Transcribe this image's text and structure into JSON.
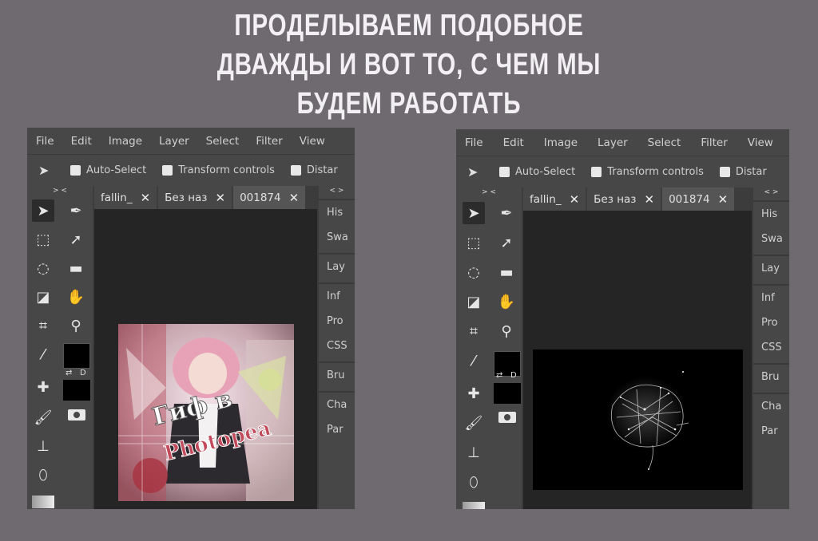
{
  "caption": {
    "line1": "ПРОДЕЛЫВАЕМ ПОДОБНОЕ",
    "line2": "ДВАЖДЫ И ВОТ ТО, С ЧЕМ МЫ",
    "line3": "БУДЕМ РАБОТАТЬ"
  },
  "left_app": {
    "menu": [
      "File",
      "Edit",
      "Image",
      "Layer",
      "Select",
      "Filter",
      "View"
    ],
    "options": {
      "auto_select": "Auto-Select",
      "transform_controls": "Transform controls",
      "distance": "Distar"
    },
    "toolbar_collapse": "> <",
    "panel_collapse": "< >",
    "tabs": [
      {
        "label": "fallin_",
        "close": "✕"
      },
      {
        "label": "Без наз",
        "close": "✕"
      },
      {
        "label": "001874",
        "close": "✕"
      }
    ],
    "panels": {
      "group1": [
        "His",
        "Swa"
      ],
      "group2": [
        "Lay"
      ],
      "group3": [
        "Inf",
        "Pro",
        "CSS"
      ],
      "group4": [
        "Bru"
      ],
      "group5": [
        "Cha",
        "Par"
      ]
    },
    "artwork_text": {
      "line1": "Гиф в",
      "line2": "Photopea"
    },
    "swatch_label": "D"
  },
  "right_app": {
    "menu": [
      "File",
      "Edit",
      "Image",
      "Layer",
      "Select",
      "Filter",
      "View"
    ],
    "options": {
      "auto_select": "Auto-Select",
      "transform_controls": "Transform controls",
      "distance": "Distar"
    },
    "toolbar_collapse": "> <",
    "panel_collapse": "< >",
    "tabs": [
      {
        "label": "fallin_",
        "close": "✕"
      },
      {
        "label": "Без наз",
        "close": "✕"
      },
      {
        "label": "001874",
        "close": "✕"
      }
    ],
    "panels": {
      "group1": [
        "His",
        "Swa"
      ],
      "group2": [
        "Lay"
      ],
      "group3": [
        "Inf",
        "Pro",
        "CSS"
      ],
      "group4": [
        "Bru"
      ],
      "group5": [
        "Cha",
        "Par"
      ]
    },
    "swatch_label": "D"
  },
  "colors": {
    "background": "#6e6a70",
    "app_panel": "#474747",
    "canvas_bg": "#252525",
    "caption_text": "#f2f0f2"
  }
}
